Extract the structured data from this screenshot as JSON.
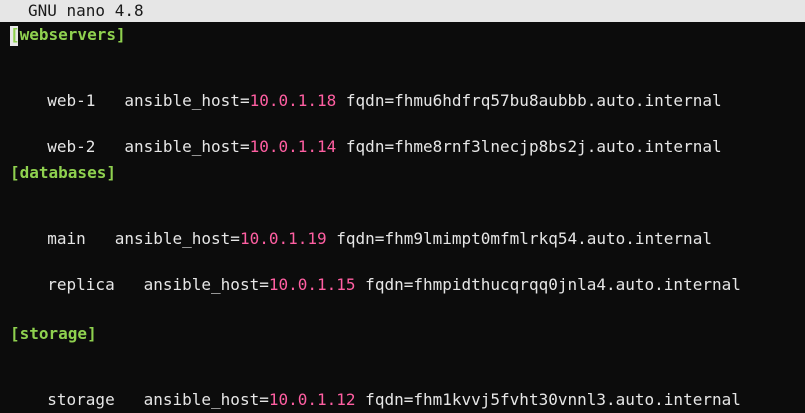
{
  "app": {
    "title": "GNU nano 4.8"
  },
  "editor": {
    "sections": [
      {
        "header": "[webservers]",
        "hosts": [
          {
            "name": "web-1",
            "gap": "   ",
            "key": "ansible_host=",
            "ip": "10.0.1.18",
            "rest": " fqdn=fhmu6hdfrq57bu8aubbb.auto.internal"
          },
          {
            "name": "web-2",
            "gap": "   ",
            "key": "ansible_host=",
            "ip": "10.0.1.14",
            "rest": " fqdn=fhme8rnf3lnecjp8bs2j.auto.internal"
          }
        ]
      },
      {
        "header": "[databases]",
        "hosts": [
          {
            "name": "main",
            "gap": "   ",
            "key": "ansible_host=",
            "ip": "10.0.1.19",
            "rest": " fqdn=fhm9lmimpt0mfmlrkq54.auto.internal"
          },
          {
            "name": "replica",
            "gap": "   ",
            "key": "ansible_host=",
            "ip": "10.0.1.15",
            "rest": " fqdn=fhmpidthucqrqq0jnla4.auto.internal"
          }
        ]
      },
      {
        "header": "[storage]",
        "hosts": [
          {
            "name": "storage",
            "gap": "   ",
            "key": "ansible_host=",
            "ip": "10.0.1.12",
            "rest": " fqdn=fhm1kvvj5fvht30vnnl3.auto.internal"
          }
        ]
      }
    ]
  },
  "colors": {
    "section": "#8fd14f",
    "ip": "#ff5fa2",
    "text": "#e6e6e6",
    "background": "#0c0c0c",
    "titlebar": "#e6e6e6"
  }
}
